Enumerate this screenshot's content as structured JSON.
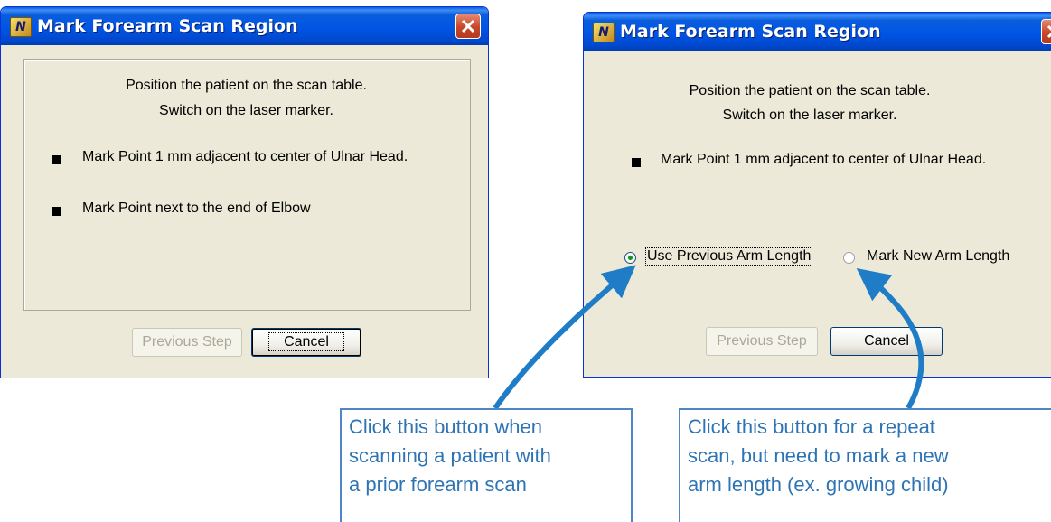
{
  "dialog_left": {
    "title": "Mark Forearm Scan Region",
    "instructions": [
      "Position the patient on the scan table.",
      "Switch on the laser marker."
    ],
    "steps": [
      "Mark Point 1 mm adjacent to center of Ulnar Head.",
      "Mark Point next to the end of Elbow"
    ],
    "buttons": {
      "previous": "Previous Step",
      "cancel": "Cancel"
    }
  },
  "dialog_right": {
    "title": "Mark Forearm Scan Region",
    "instructions": [
      "Position the patient on the scan table.",
      "Switch on the laser marker."
    ],
    "steps": [
      "Mark Point 1 mm adjacent to center of Ulnar Head."
    ],
    "radio_options": [
      {
        "label": "Use Previous Arm Length",
        "selected": true
      },
      {
        "label": "Mark New Arm Length",
        "selected": false
      }
    ],
    "buttons": {
      "previous": "Previous Step",
      "cancel": "Cancel"
    }
  },
  "callouts": {
    "left": [
      "Click this button when",
      "scanning a patient with",
      "a prior forearm scan"
    ],
    "right": [
      "Click this button for a repeat",
      "scan, but need to mark a new",
      "arm length (ex. growing child)"
    ]
  },
  "colors": {
    "titlebar": "#0055e5",
    "dialog_bg": "#ece9d8",
    "callout": "#2e74b5",
    "arrow": "#1f7dc8"
  }
}
